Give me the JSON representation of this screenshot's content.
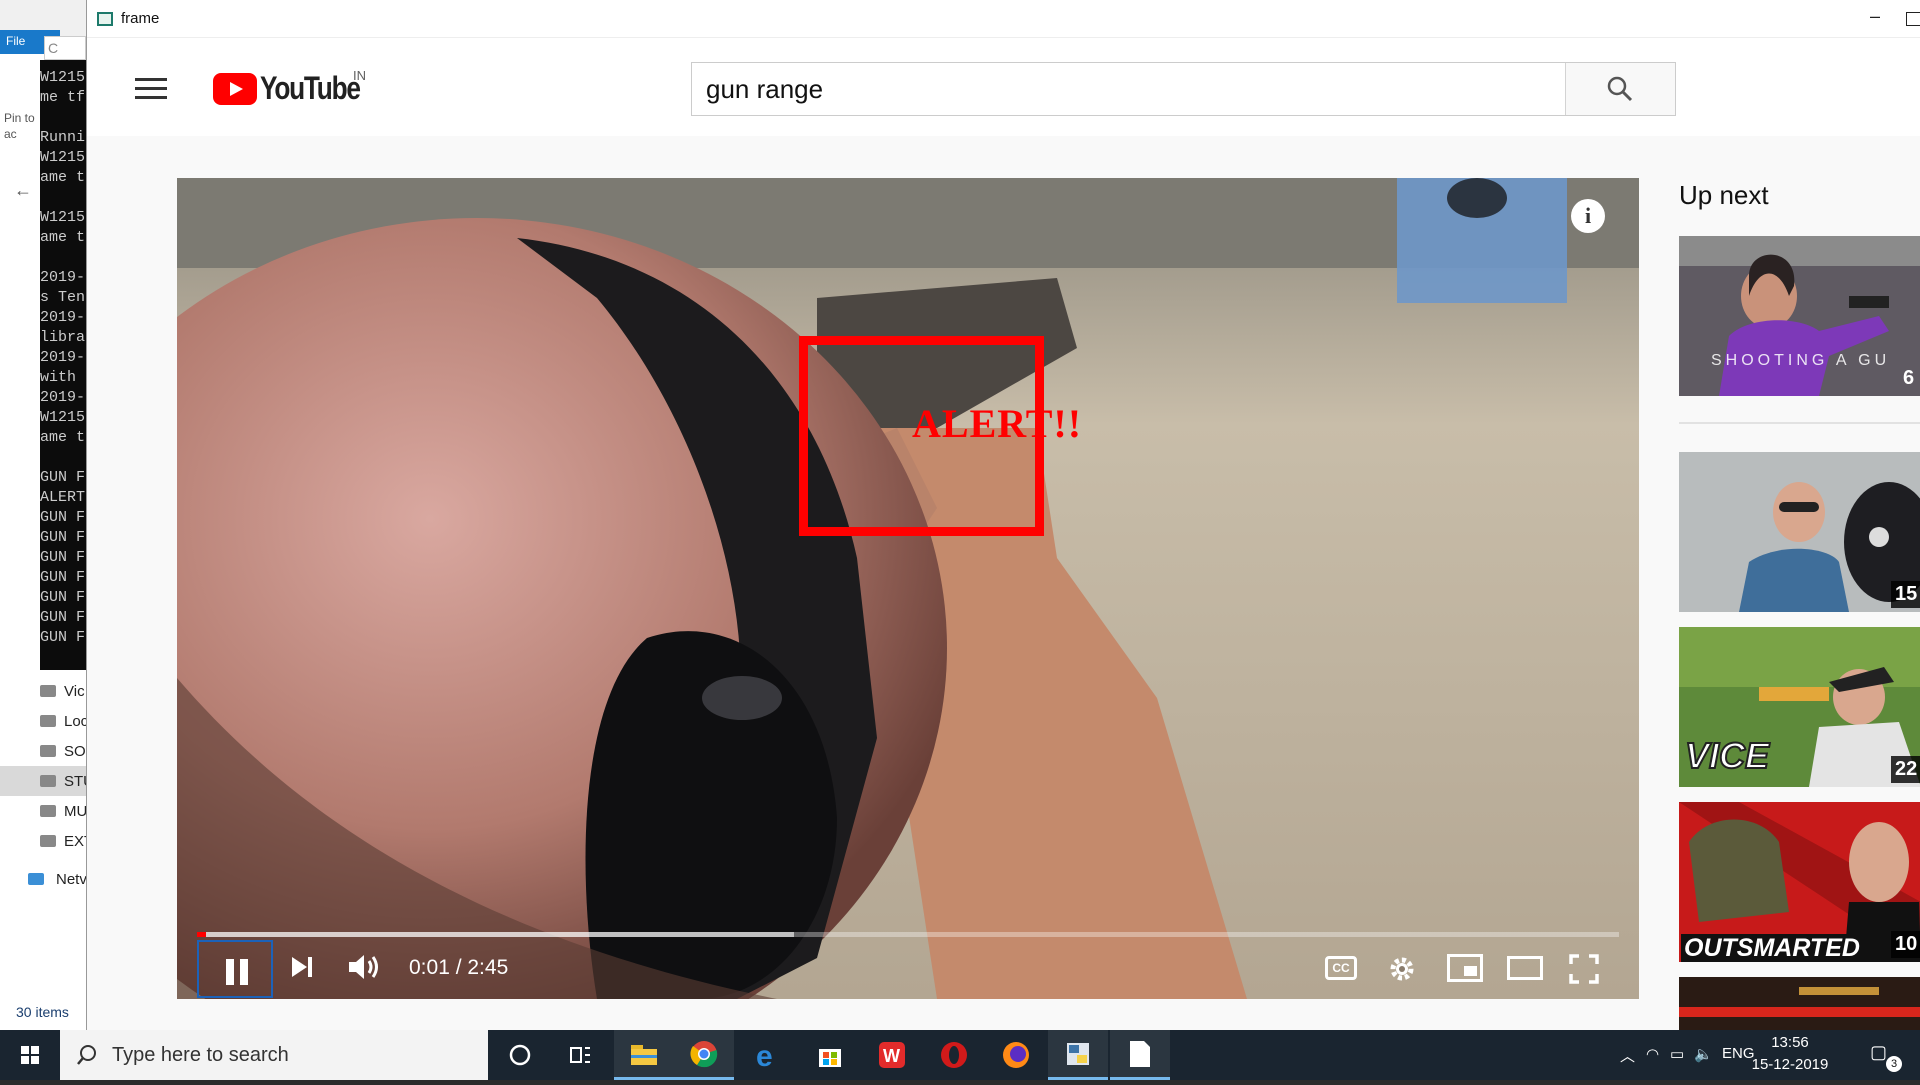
{
  "explorer": {
    "file_tab": "File",
    "pin_label": "Pin to\nac",
    "items_count": "30 items",
    "tree": [
      "Vic",
      "Loc",
      "SO",
      "STU",
      "MU",
      "EXT",
      "Netv"
    ]
  },
  "console": {
    "title": "C",
    "lines": [
      "W1215",
      "me tf",
      "",
      "Runni",
      "W1215",
      "ame t",
      "",
      "W1215",
      "ame t",
      "",
      "2019-",
      "s Ten",
      "2019-",
      "libra",
      "2019-",
      "with",
      "2019-",
      "W1215",
      "ame t",
      "",
      "GUN F",
      "ALERT",
      "GUN F",
      "GUN F",
      "GUN F",
      "GUN F",
      "GUN F",
      "GUN F",
      "GUN F"
    ]
  },
  "window": {
    "title": "frame",
    "minimize": "–"
  },
  "youtube": {
    "logo_text": "YouTube",
    "region": "IN",
    "search_value": "gun range",
    "brand_color": "#ff0000"
  },
  "player": {
    "alert_text": "ALERT!!",
    "alert_color": "#ff0000",
    "time": "0:01 / 2:45",
    "cc_label": "CC",
    "played_fraction": 0.0061,
    "buffered_fraction": 0.42
  },
  "upnext": {
    "title": "Up next",
    "items": [
      {
        "caption": "SHOOTING A GU",
        "duration": "6"
      },
      {
        "caption": "",
        "duration": "15"
      },
      {
        "caption": "VICE",
        "duration": "22"
      },
      {
        "caption": "OUTSMARTED",
        "duration": "10"
      }
    ]
  },
  "taskbar": {
    "search_placeholder": "Type here to search",
    "language": "ENG",
    "time": "13:56",
    "date": "15-12-2019",
    "notifications": "3"
  }
}
